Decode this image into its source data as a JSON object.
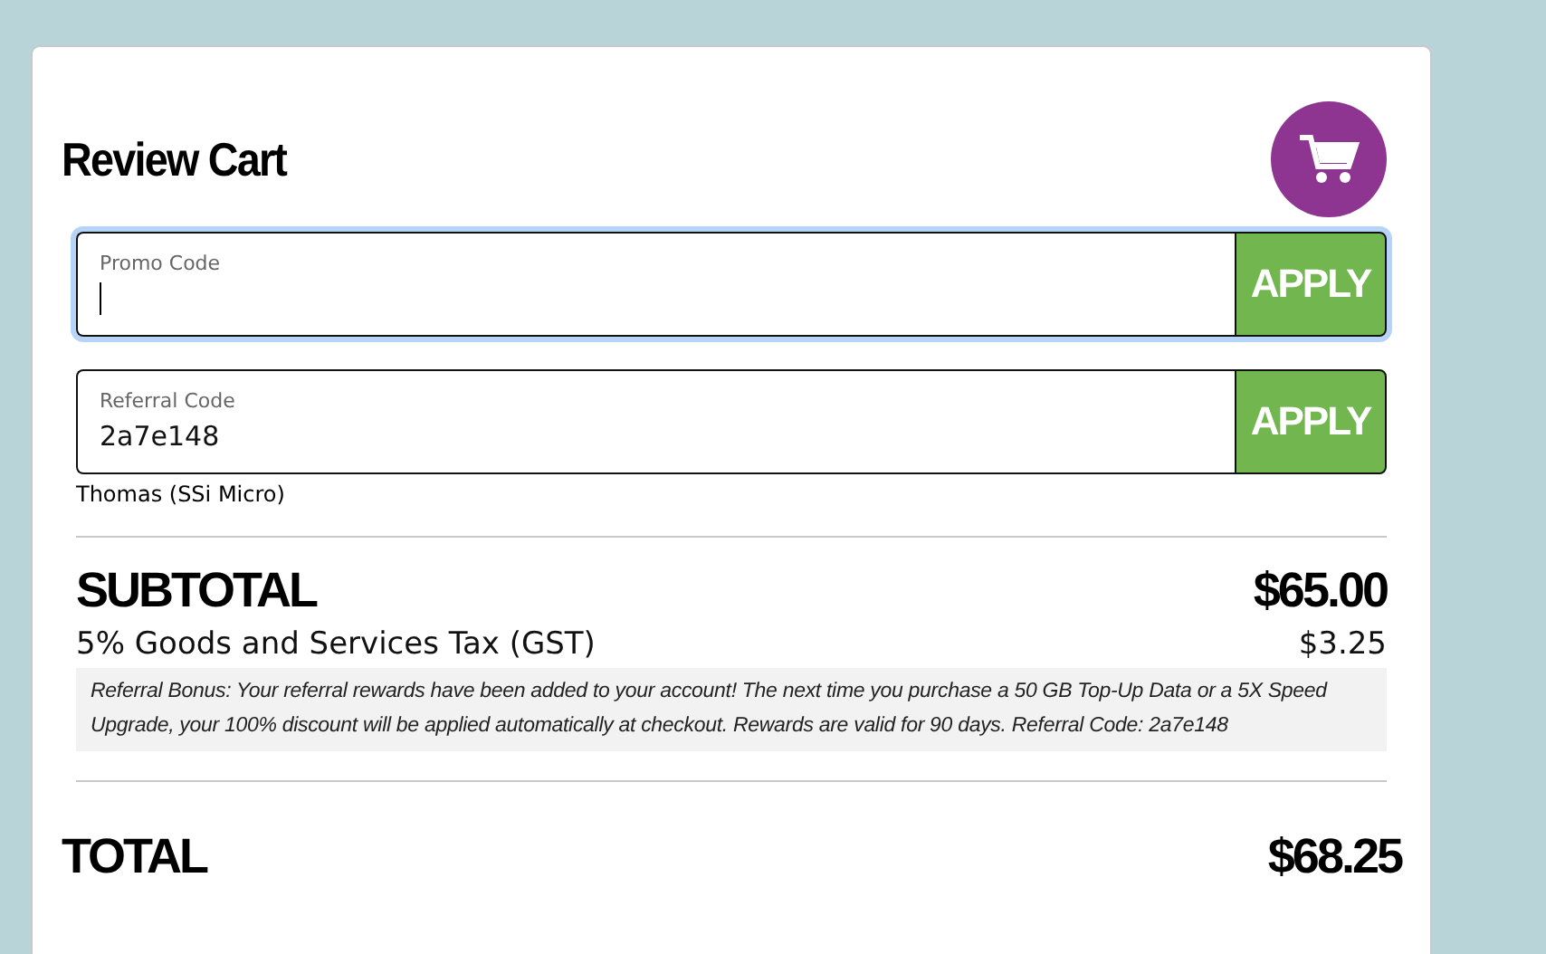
{
  "title": "Review Cart",
  "code_fields": [
    {
      "label": "Promo Code",
      "focused": true,
      "button": "APPLY"
    },
    {
      "label": "Referral Code",
      "value": "2a7e148",
      "focused": false,
      "button": "APPLY",
      "note": "Thomas (SSi Micro)"
    }
  ],
  "subtotal": {
    "label": "SUBTOTAL",
    "amount": "$65.00"
  },
  "tax": {
    "label": "5% Goods and Services Tax (GST)",
    "amount": "$3.25"
  },
  "referral_notice": "Referral Bonus: Your referral rewards have been added to your account! The next time you purchase a 50 GB Top-Up Data or a 5X Speed Upgrade, your 100% discount will be applied automatically at checkout. Rewards are valid for 90 days. Referral Code: 2a7e148",
  "total": {
    "label": "TOTAL",
    "amount": "$68.25"
  }
}
